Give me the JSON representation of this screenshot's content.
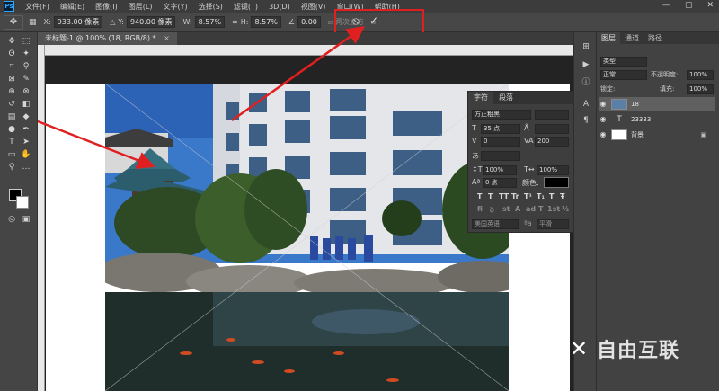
{
  "app": {
    "logo": "Ps"
  },
  "menu": [
    "文件(F)",
    "编辑(E)",
    "图像(I)",
    "图层(L)",
    "文字(Y)",
    "选择(S)",
    "滤镜(T)",
    "3D(D)",
    "视图(V)",
    "窗口(W)",
    "帮助(H)"
  ],
  "window_controls": [
    "—",
    "▢",
    "✕"
  ],
  "options": {
    "x_label": "X:",
    "x_value": "933.00 像素",
    "y_label": "Y:",
    "y_value": "940.00 像素",
    "w_label": "W:",
    "w_value": "8.57%",
    "h_label": "H:",
    "h_value": "8.57%",
    "angle_value": "0.00",
    "interp_label": "两次立方",
    "cancel_icon": "⦸",
    "commit_icon": "✓"
  },
  "tab": {
    "title": "未标题-1 @ 100% (18, RGB/8) *",
    "close": "×"
  },
  "char_panel": {
    "tabs": [
      "字符",
      "段落"
    ],
    "font_family": "方正粗黑",
    "font_size": "35 点",
    "tracking": "200",
    "leading": "0",
    "vscale": "100%",
    "hscale": "100%",
    "baseline": "0 点",
    "color_label": "颜色:",
    "lang": "美国英语",
    "aa": "平滑",
    "style_buttons": [
      "T",
      "T",
      "TT",
      "Tr",
      "T¹",
      "T₁",
      "T",
      "Ŧ"
    ],
    "features": [
      "fi",
      "ꝺ",
      "st",
      "A",
      "ad",
      "T",
      "1st",
      "½"
    ]
  },
  "layers_panel": {
    "tabs": [
      "图层",
      "通道",
      "路径"
    ],
    "kind_label": "类型",
    "blend_mode": "正常",
    "opacity_label": "不透明度:",
    "opacity": "100%",
    "lock_label": "锁定:",
    "fill_label": "填充:",
    "fill": "100%",
    "layers": [
      {
        "name": "18",
        "type": "image",
        "selected": true
      },
      {
        "name": "23333",
        "type": "text",
        "selected": false
      },
      {
        "name": "背景",
        "type": "background",
        "selected": false
      }
    ],
    "lock_icon": "🔒"
  },
  "watermark": {
    "text": "自由互联"
  },
  "colors": {
    "menu_bg": "#3c3c3c",
    "panel_bg": "#424242",
    "canvas_bg": "#232323",
    "annotation_red": "#e02020",
    "accent": "#31a8ff"
  }
}
